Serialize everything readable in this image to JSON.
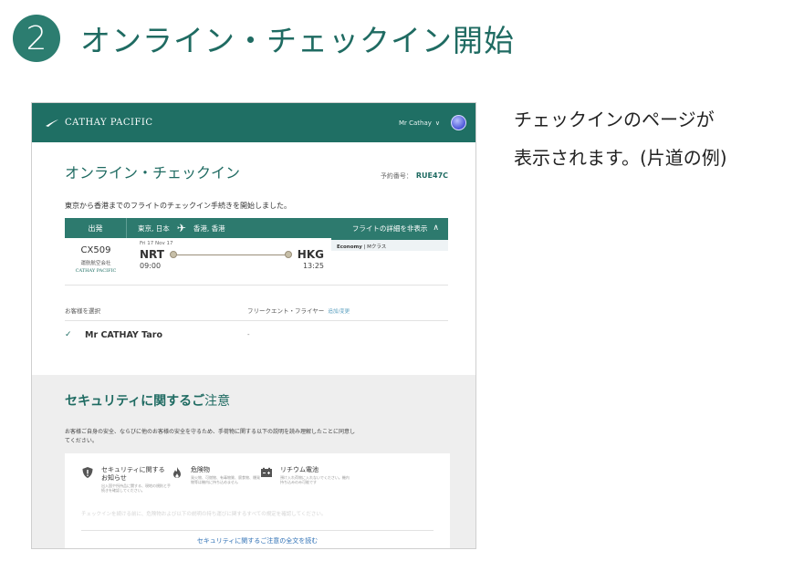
{
  "step": {
    "number": "2",
    "title": "オンライン・チェックイン開始"
  },
  "description": {
    "line1": "チェックインのページが",
    "line2": "表示されます。(片道の例)"
  },
  "screenshot": {
    "header": {
      "brand": "CATHAY PACIFIC",
      "user": "Mr Cathay",
      "user_chevron": "∨",
      "brand_color": "#1f6f64"
    },
    "page_title": "オンライン・チェックイン",
    "booking_label": "予約番号：",
    "booking_ref": "RUE47C",
    "intro": "東京から香港までのフライトのチェックイン手続きを開始しました。",
    "flight_bar": {
      "depart_label": "出発",
      "origin": "東京, 日本",
      "plane_icon": "✈",
      "destination": "香港, 香港",
      "detail_label": "フライトの詳細を非表示",
      "detail_caret": "∧"
    },
    "flight": {
      "number": "CX509",
      "operator": "運航航空会社",
      "operator_logo": "CATHAY PACIFIC",
      "date": "Fri 17 Nov 17",
      "from_code": "NRT",
      "to_code": "HKG",
      "dep_time": "09:00",
      "arr_time": "13:25",
      "cabin": "Economy",
      "class": "Mクラス"
    },
    "passengers": {
      "select_label": "お客様を選択",
      "ff_label": "フリークエント・フライヤー",
      "edit_label": "追加/変更",
      "check": "✓",
      "name": "Mr CATHAY Taro",
      "ff_value": "-"
    },
    "security": {
      "title_bold": "セキュリティに関するご",
      "title_rest": "注意",
      "text": "お客様ご自身の安全、ならびに他のお客様の安全を守るため、手荷物に関する以下の説明を読み理解したことに同意してください。",
      "items": [
        {
          "title": "セキュリティに関するお知らせ",
          "sub": "出入国や所持品に関する、現地の規則と手続きを確認してください。"
        },
        {
          "title": "危険物",
          "sub": "発火物、可燃物、有毒物質、腐食物、爆発物等は機内に持ち込めません"
        },
        {
          "title": "リチウム電池",
          "sub": "預け入れ荷物に入れないでください。機内持ち込みのみ可能です"
        }
      ],
      "faded_text": "チェックインを続ける前に、危険物および以下の説明の持ち運びに関するすべての規定を確認してください。",
      "link": "セキュリティに関するご注意の全文を読む"
    }
  }
}
